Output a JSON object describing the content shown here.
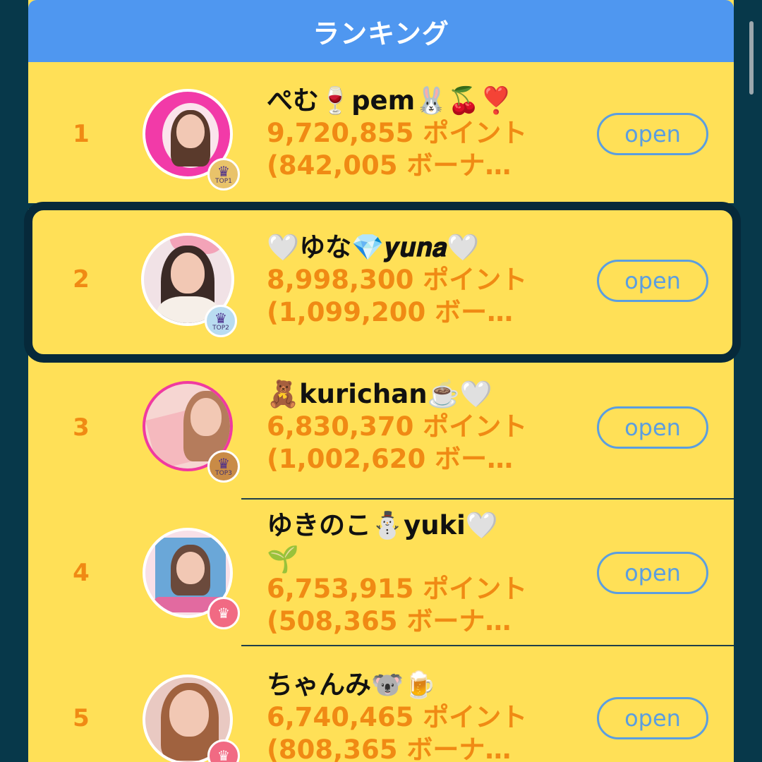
{
  "header": {
    "title": "ランキング"
  },
  "rows": [
    {
      "rank": "1",
      "name": "ぺむ🍷pem🐰🍒❣️",
      "points": "9,720,855 ポイント",
      "bonus": "(842,005 ボーナ…",
      "badge": "TOP1",
      "open_label": "open"
    },
    {
      "rank": "2",
      "name": "🤍ゆな💎𝒚𝒖𝒏𝒂🤍",
      "points": "8,998,300 ポイント",
      "bonus": "(1,099,200 ボー…",
      "badge": "TOP2",
      "open_label": "open"
    },
    {
      "rank": "3",
      "name": "🧸kurichan☕️🤍",
      "points": "6,830,370 ポイント",
      "bonus": "(1,002,620 ボー…",
      "badge": "TOP3",
      "open_label": "open"
    },
    {
      "rank": "4",
      "name": "ゆきのこ⛄️yuki🤍",
      "name2": "🌱",
      "points": "6,753,915 ポイント",
      "bonus": "(508,365 ボーナ…",
      "open_label": "open"
    },
    {
      "rank": "5",
      "name": "ちゃんみ🐨🍺",
      "points": "6,740,465 ポイント",
      "bonus": "(808,365 ボーナ…",
      "open_label": "open"
    }
  ],
  "colors": {
    "header": "#4f97f0",
    "row_bg": "#ffe057",
    "rank_text": "#f08a14",
    "open_border": "#5b9ee0",
    "page_bg": "#07384a"
  }
}
